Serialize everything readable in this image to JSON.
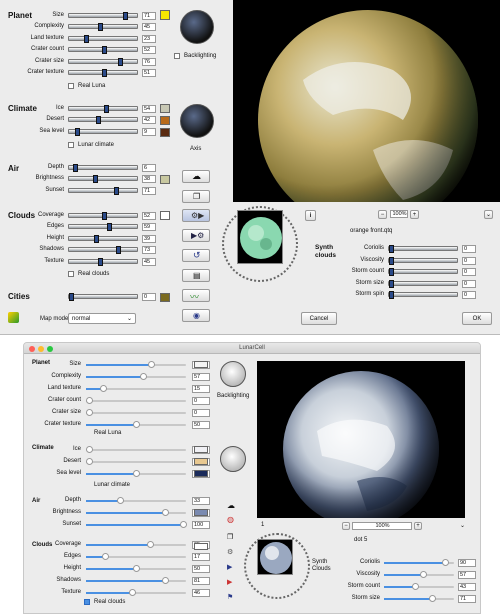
{
  "top": {
    "planet": {
      "title": "Planet",
      "rows": [
        {
          "label": "Size",
          "value": "71",
          "pct": 0.85
        },
        {
          "label": "Complexity",
          "value": "45",
          "pct": 0.45
        },
        {
          "label": "Land texture",
          "value": "23",
          "pct": 0.23
        },
        {
          "label": "Crater count",
          "value": "52",
          "pct": 0.52
        },
        {
          "label": "Crater size",
          "value": "76",
          "pct": 0.76
        },
        {
          "label": "Crater texture",
          "value": "51",
          "pct": 0.51
        }
      ],
      "real_luna": "Real Luna",
      "backlighting": "Backlighting"
    },
    "climate": {
      "title": "Climate",
      "rows": [
        {
          "label": "Ice",
          "value": "54",
          "pct": 0.54
        },
        {
          "label": "Desert",
          "value": "42",
          "pct": 0.42
        },
        {
          "label": "Sea level",
          "value": "9",
          "pct": 0.09
        }
      ],
      "lunar_climate": "Lunar climate",
      "axis": "Axis"
    },
    "air": {
      "title": "Air",
      "rows": [
        {
          "label": "Depth",
          "value": "6",
          "pct": 0.06
        },
        {
          "label": "Brightness",
          "value": "38",
          "pct": 0.38
        },
        {
          "label": "Sunset",
          "value": "71",
          "pct": 0.71
        }
      ]
    },
    "clouds": {
      "title": "Clouds",
      "rows": [
        {
          "label": "Coverage",
          "value": "52",
          "pct": 0.52
        },
        {
          "label": "Edges",
          "value": "59",
          "pct": 0.59
        },
        {
          "label": "Height",
          "value": "39",
          "pct": 0.39
        },
        {
          "label": "Shadows",
          "value": "73",
          "pct": 0.73
        },
        {
          "label": "Texture",
          "value": "45",
          "pct": 0.45
        }
      ],
      "real_clouds": "Real clouds"
    },
    "cities": {
      "title": "Cities",
      "value": "0"
    },
    "map_mode_label": "Map mode",
    "map_mode_value": "normal",
    "zoom": "100%",
    "preset": "orange front.qtq",
    "synth": {
      "title": "Synth clouds",
      "rows": [
        {
          "label": "Coriolis",
          "value": "0"
        },
        {
          "label": "Viscosity",
          "value": "0"
        },
        {
          "label": "Storm count",
          "value": "0"
        },
        {
          "label": "Storm size",
          "value": "0"
        },
        {
          "label": "Storm spin",
          "value": "0"
        }
      ]
    },
    "cancel": "Cancel",
    "ok": "OK",
    "info": "i",
    "minus": "−",
    "plus": "+"
  },
  "bottom": {
    "title": "LunarCell",
    "planet": {
      "title": "Planet",
      "rows": [
        {
          "label": "Size",
          "value": "66",
          "pct": 0.66
        },
        {
          "label": "Complexity",
          "value": "57",
          "pct": 0.57
        },
        {
          "label": "Land texture",
          "value": "15",
          "pct": 0.15
        },
        {
          "label": "Crater count",
          "value": "0",
          "pct": 0
        },
        {
          "label": "Crater size",
          "value": "0",
          "pct": 0
        },
        {
          "label": "Crater texture",
          "value": "50",
          "pct": 0.5
        }
      ],
      "real_luna": "Real Luna",
      "backlighting": "Backlighting"
    },
    "climate": {
      "title": "Climate",
      "rows": [
        {
          "label": "Ice",
          "value": "0",
          "pct": 0
        },
        {
          "label": "Desert",
          "value": "0",
          "pct": 0
        },
        {
          "label": "Sea level",
          "value": "50",
          "pct": 0.5
        }
      ],
      "lunar_climate": "Lunar climate"
    },
    "air": {
      "title": "Air",
      "rows": [
        {
          "label": "Depth",
          "value": "33",
          "pct": 0.33
        },
        {
          "label": "Brightness",
          "value": "81",
          "pct": 0.81
        },
        {
          "label": "Sunset",
          "value": "100",
          "pct": 1.0
        }
      ]
    },
    "clouds": {
      "title": "Clouds",
      "rows": [
        {
          "label": "Coverage",
          "value": "65",
          "pct": 0.65
        },
        {
          "label": "Edges",
          "value": "17",
          "pct": 0.17
        },
        {
          "label": "Height",
          "value": "50",
          "pct": 0.5
        },
        {
          "label": "Shadows",
          "value": "81",
          "pct": 0.81
        },
        {
          "label": "Texture",
          "value": "46",
          "pct": 0.46
        }
      ],
      "real_clouds": "Real clouds"
    },
    "zoom": "100%",
    "preset": "dot 5",
    "page": "1",
    "synth": {
      "title": "Synth Clouds",
      "rows": [
        {
          "label": "Coriolis",
          "value": "90",
          "pct": 0.9
        },
        {
          "label": "Viscosity",
          "value": "57",
          "pct": 0.57
        },
        {
          "label": "Storm count",
          "value": "43",
          "pct": 0.43
        },
        {
          "label": "Storm size",
          "value": "71",
          "pct": 0.71
        }
      ]
    }
  }
}
